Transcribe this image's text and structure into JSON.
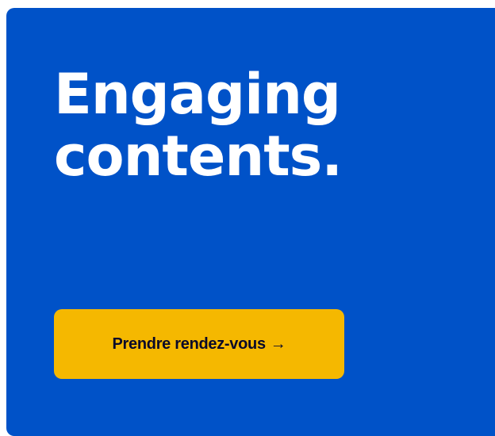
{
  "hero": {
    "headline_line1": "Engaging",
    "headline_line2": "contents.",
    "background_color": "#0052c8"
  },
  "cta": {
    "label": "Prendre rendez-vous",
    "arrow": "→",
    "arrow_icon": "arrow-right-icon",
    "background_color": "#f5b800"
  }
}
